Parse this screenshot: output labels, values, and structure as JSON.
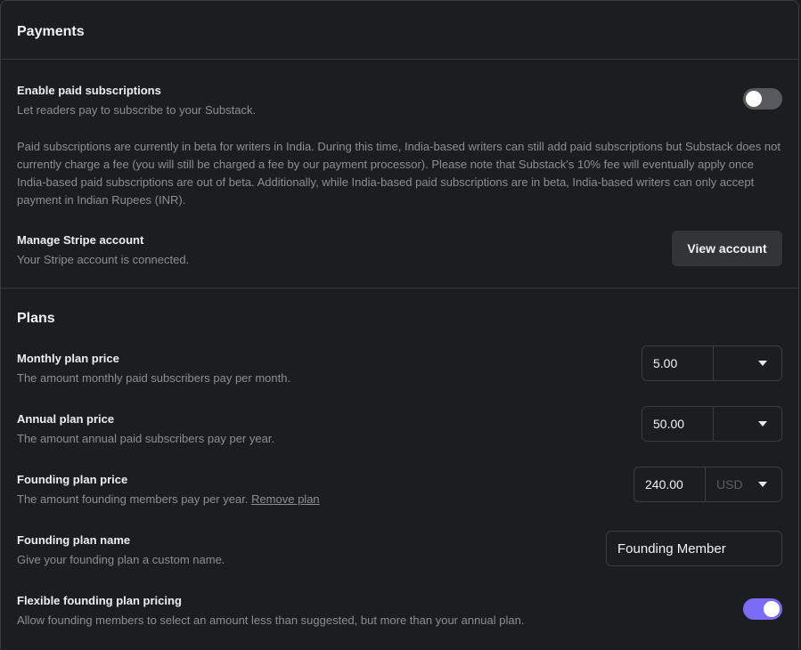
{
  "payments": {
    "title": "Payments",
    "enable_paid": {
      "title": "Enable paid subscriptions",
      "desc": "Let readers pay to subscribe to your Substack.",
      "enabled": false
    },
    "note": "Paid subscriptions are currently in beta for writers in India. During this time, India-based writers can still add paid subscriptions but Substack does not currently charge a fee (you will still be charged a fee by our payment processor). Please note that Substack's 10% fee will eventually apply once India-based paid subscriptions are out of beta. Additionally, while India-based paid subscriptions are in beta, India-based writers can only accept payment in Indian Rupees (INR).",
    "stripe": {
      "title": "Manage Stripe account",
      "desc": "Your Stripe account is connected.",
      "button": "View account"
    }
  },
  "plans": {
    "title": "Plans",
    "monthly": {
      "title": "Monthly plan price",
      "desc": "The amount monthly paid subscribers pay per month.",
      "value": "5.00",
      "currency": ""
    },
    "annual": {
      "title": "Annual plan price",
      "desc": "The amount annual paid subscribers pay per year.",
      "value": "50.00",
      "currency": ""
    },
    "founding": {
      "title": "Founding plan price",
      "desc": "The amount founding members pay per year.",
      "remove_link": "Remove plan",
      "value": "240.00",
      "currency": "USD"
    },
    "founding_name": {
      "title": "Founding plan name",
      "desc": "Give your founding plan a custom name.",
      "value": "Founding Member"
    },
    "flexible": {
      "title": "Flexible founding plan pricing",
      "desc": "Allow founding members to select an amount less than suggested, but more than your annual plan.",
      "enabled": true
    }
  },
  "colors": {
    "background": "#1c1d1f",
    "toggle_on": "#7b6cf6",
    "toggle_off": "#58595d",
    "button_bg": "#333437"
  }
}
